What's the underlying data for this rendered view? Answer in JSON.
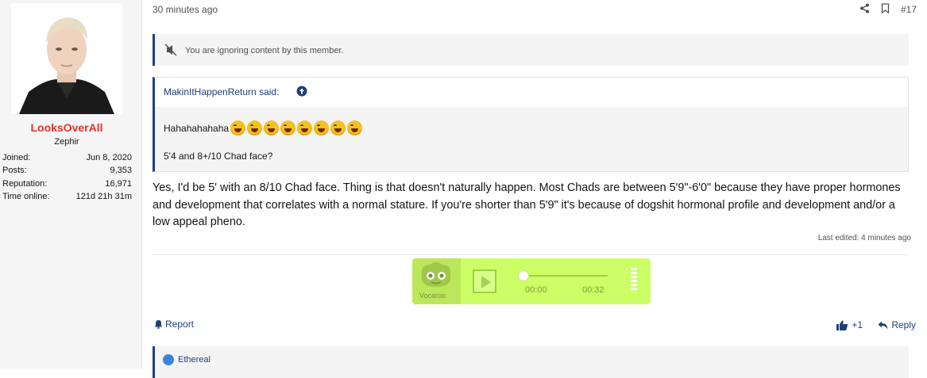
{
  "user": {
    "name": "LooksOverAll",
    "title": "Zephir",
    "stats": [
      {
        "label": "Joined:",
        "value": "Jun 8, 2020"
      },
      {
        "label": "Posts:",
        "value": "9,353"
      },
      {
        "label": "Reputation:",
        "value": "16,971"
      },
      {
        "label": "Time online:",
        "value": "121d 21h 31m"
      }
    ]
  },
  "post": {
    "time": "30 minutes ago",
    "number": "#17",
    "ignored_text": "You are ignoring content by this member.",
    "quote": {
      "author": "MakinItHappenReturn said:",
      "line1": "Hahahahahaha",
      "line2": "5'4 and 8+/10 Chad face?"
    },
    "body": "Yes, I'd be 5' with an 8/10 Chad face. Thing is that doesn't naturally happen. Most Chads are between 5'9\"-6'0\" because they have proper hormones and development that correlates with a normal stature. If you're shorter than 5'9\" it's because of dogshit hormonal profile and development and/or a low appeal pheno.",
    "last_edited": "Last edited: 4 minutes ago"
  },
  "vocaroo": {
    "label": "Vocaroo",
    "current_time": "00:00",
    "duration": "00:32"
  },
  "actions": {
    "report": "Report",
    "like_count": "+1",
    "reply": "Reply"
  },
  "reactions": {
    "user": "Ethereal"
  },
  "colors": {
    "username": "#e8302a",
    "accent": "#1f3f7a",
    "vocaroo_bg": "#ccff66"
  }
}
